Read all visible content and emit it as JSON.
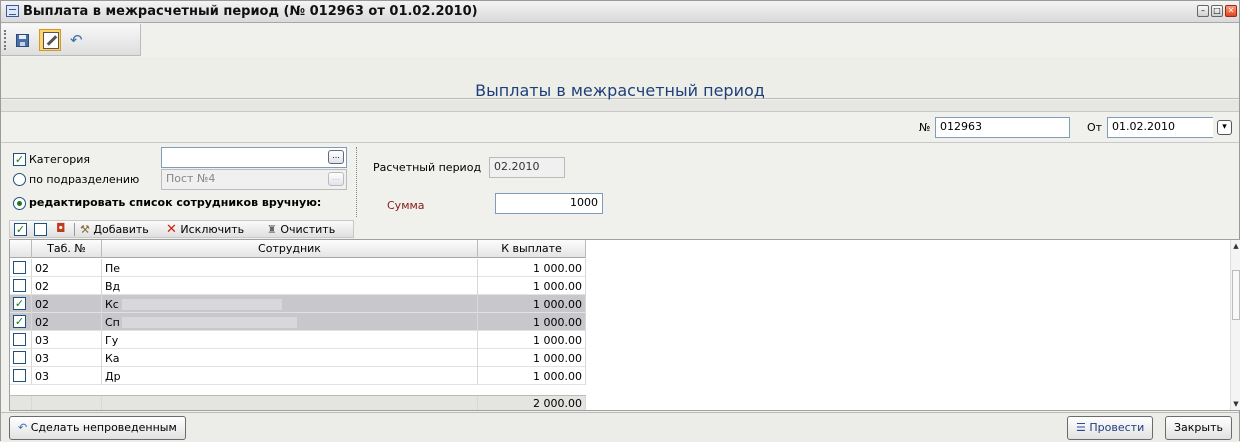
{
  "window": {
    "title": "Выплата в межрасчетный период (№ 012963 от 01.02.2010)",
    "controls": [
      "minimize-icon",
      "maximize-icon",
      "close-icon"
    ]
  },
  "toolbar": {
    "buttons": [
      {
        "icon": "save-icon"
      },
      {
        "icon": "edit-icon",
        "active": true
      },
      {
        "icon": "undo-icon"
      }
    ]
  },
  "header": {
    "title": "Выплаты в межрасчетный период"
  },
  "document": {
    "number_label": "№",
    "number_value": "012963",
    "date_label": "От",
    "date_value": "01.02.2010"
  },
  "filters": {
    "category_label": "Категория",
    "category_value": "",
    "category_checked": true,
    "by_department_label": "по подразделению",
    "department_value": "Пост №4",
    "manual_label": "редактировать список сотрудников вручную:"
  },
  "period": {
    "label": "Расчетный период",
    "value": "02.2010",
    "sum_label": "Сумма",
    "sum_value": "1000"
  },
  "grid_toolbar": {
    "add_label": "Добавить",
    "exclude_label": "Исключить",
    "clear_label": "Очистить"
  },
  "grid": {
    "columns": [
      "Таб. №",
      "Сотрудник",
      "К выплате"
    ],
    "rows": [
      {
        "checked": false,
        "tab": "02",
        "employee": "Пе",
        "amount": "1 000.00",
        "selected": false
      },
      {
        "checked": false,
        "tab": "02",
        "employee": "Вд",
        "amount": "1 000.00",
        "selected": false
      },
      {
        "checked": true,
        "tab": "02",
        "employee": "Кс",
        "amount": "1 000.00",
        "selected": true
      },
      {
        "checked": true,
        "tab": "02",
        "employee": "Сп",
        "amount": "1 000.00",
        "selected": true
      },
      {
        "checked": false,
        "tab": "03",
        "employee": "Гу",
        "amount": "1 000.00",
        "selected": false
      },
      {
        "checked": false,
        "tab": "03",
        "employee": "Ка",
        "amount": "1 000.00",
        "selected": false
      },
      {
        "checked": false,
        "tab": "03",
        "employee": "Др",
        "amount": "1 000.00",
        "selected": false
      }
    ],
    "total": "2 000.00"
  },
  "footer": {
    "unpost_label": "Сделать непроведенным",
    "post_label": "Провести",
    "close_label": "Закрыть"
  },
  "colors": {
    "title_blue": "#1f3f7a",
    "sum_label_red": "#8b1a1a",
    "check_green": "#1a7a1a",
    "selected_row": "#c8c8cc"
  }
}
